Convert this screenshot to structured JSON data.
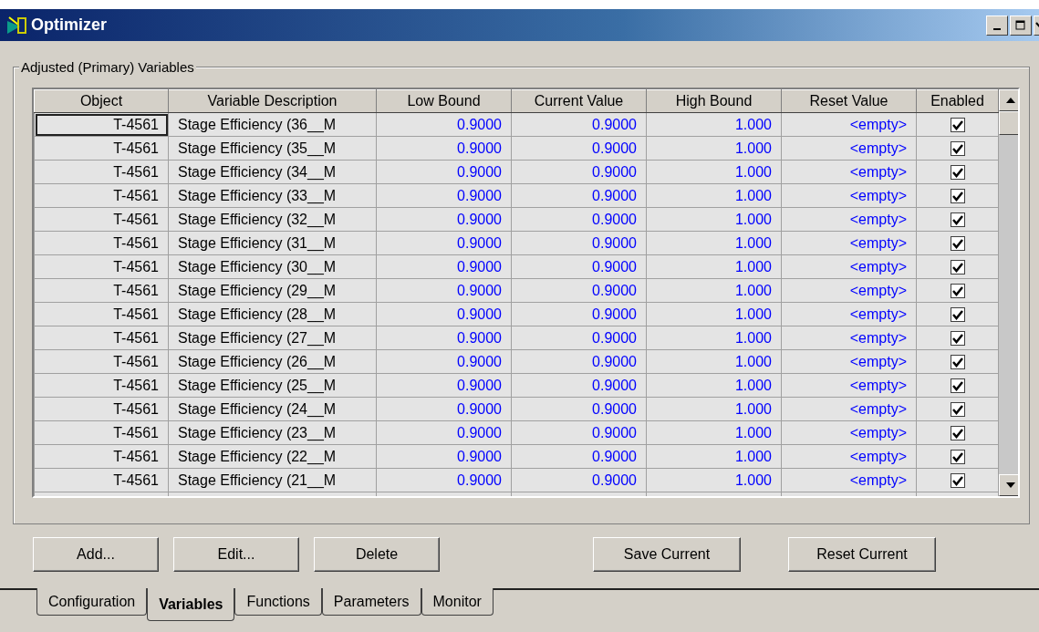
{
  "window": {
    "title": "Optimizer"
  },
  "group": {
    "title": "Adjusted (Primary) Variables"
  },
  "table": {
    "columns": [
      "Object",
      "Variable Description",
      "Low Bound",
      "Current Value",
      "High Bound",
      "Reset Value",
      "Enabled"
    ],
    "rows": [
      {
        "object": "T-4561",
        "description": "Stage Efficiency (36__M",
        "low": "0.9000",
        "current": "0.9000",
        "high": "1.000",
        "reset": "<empty>",
        "enabled": true,
        "focused": true
      },
      {
        "object": "T-4561",
        "description": "Stage Efficiency (35__M",
        "low": "0.9000",
        "current": "0.9000",
        "high": "1.000",
        "reset": "<empty>",
        "enabled": true,
        "focused": false
      },
      {
        "object": "T-4561",
        "description": "Stage Efficiency (34__M",
        "low": "0.9000",
        "current": "0.9000",
        "high": "1.000",
        "reset": "<empty>",
        "enabled": true,
        "focused": false
      },
      {
        "object": "T-4561",
        "description": "Stage Efficiency (33__M",
        "low": "0.9000",
        "current": "0.9000",
        "high": "1.000",
        "reset": "<empty>",
        "enabled": true,
        "focused": false
      },
      {
        "object": "T-4561",
        "description": "Stage Efficiency (32__M",
        "low": "0.9000",
        "current": "0.9000",
        "high": "1.000",
        "reset": "<empty>",
        "enabled": true,
        "focused": false
      },
      {
        "object": "T-4561",
        "description": "Stage Efficiency (31__M",
        "low": "0.9000",
        "current": "0.9000",
        "high": "1.000",
        "reset": "<empty>",
        "enabled": true,
        "focused": false
      },
      {
        "object": "T-4561",
        "description": "Stage Efficiency (30__M",
        "low": "0.9000",
        "current": "0.9000",
        "high": "1.000",
        "reset": "<empty>",
        "enabled": true,
        "focused": false
      },
      {
        "object": "T-4561",
        "description": "Stage Efficiency (29__M",
        "low": "0.9000",
        "current": "0.9000",
        "high": "1.000",
        "reset": "<empty>",
        "enabled": true,
        "focused": false
      },
      {
        "object": "T-4561",
        "description": "Stage Efficiency (28__M",
        "low": "0.9000",
        "current": "0.9000",
        "high": "1.000",
        "reset": "<empty>",
        "enabled": true,
        "focused": false
      },
      {
        "object": "T-4561",
        "description": "Stage Efficiency (27__M",
        "low": "0.9000",
        "current": "0.9000",
        "high": "1.000",
        "reset": "<empty>",
        "enabled": true,
        "focused": false
      },
      {
        "object": "T-4561",
        "description": "Stage Efficiency (26__M",
        "low": "0.9000",
        "current": "0.9000",
        "high": "1.000",
        "reset": "<empty>",
        "enabled": true,
        "focused": false
      },
      {
        "object": "T-4561",
        "description": "Stage Efficiency (25__M",
        "low": "0.9000",
        "current": "0.9000",
        "high": "1.000",
        "reset": "<empty>",
        "enabled": true,
        "focused": false
      },
      {
        "object": "T-4561",
        "description": "Stage Efficiency (24__M",
        "low": "0.9000",
        "current": "0.9000",
        "high": "1.000",
        "reset": "<empty>",
        "enabled": true,
        "focused": false
      },
      {
        "object": "T-4561",
        "description": "Stage Efficiency (23__M",
        "low": "0.9000",
        "current": "0.9000",
        "high": "1.000",
        "reset": "<empty>",
        "enabled": true,
        "focused": false
      },
      {
        "object": "T-4561",
        "description": "Stage Efficiency (22__M",
        "low": "0.9000",
        "current": "0.9000",
        "high": "1.000",
        "reset": "<empty>",
        "enabled": true,
        "focused": false
      },
      {
        "object": "T-4561",
        "description": "Stage Efficiency (21__M",
        "low": "0.9000",
        "current": "0.9000",
        "high": "1.000",
        "reset": "<empty>",
        "enabled": true,
        "focused": false
      }
    ]
  },
  "buttons_left": [
    "Add...",
    "Edit...",
    "Delete"
  ],
  "buttons_right": [
    "Save Current",
    "Reset Current"
  ],
  "tabs": [
    {
      "label": "Configuration",
      "selected": false
    },
    {
      "label": "Variables",
      "selected": true
    },
    {
      "label": "Functions",
      "selected": false
    },
    {
      "label": "Parameters",
      "selected": false
    },
    {
      "label": "Monitor",
      "selected": false
    }
  ]
}
